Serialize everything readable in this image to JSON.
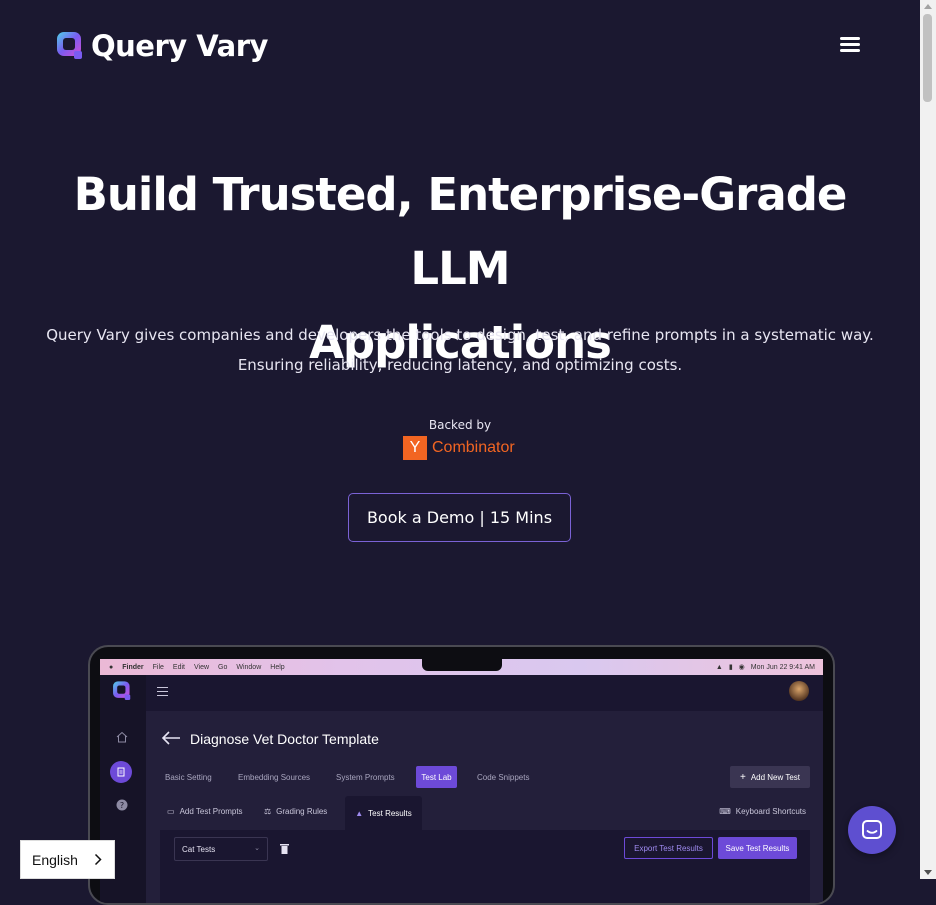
{
  "brand": {
    "name": "Query Vary"
  },
  "hero": {
    "title_line1": "Build Trusted, Enterprise-Grade LLM",
    "title_line2": "Applications",
    "subtitle_line1": "Query Vary gives companies and developers the tools to design, test, and refine prompts in a systematic way.",
    "subtitle_line2": "Ensuring reliability, reducing latency, and optimizing costs.",
    "backed_by": "Backed by",
    "yc_letter": "Y",
    "yc_name": "Combinator",
    "cta": "Book a Demo | 15 Mins"
  },
  "macbar": {
    "items": [
      "Finder",
      "File",
      "Edit",
      "View",
      "Go",
      "Window",
      "Help"
    ],
    "clock": "Mon Jun 22  9:41 AM"
  },
  "app": {
    "page_title": "Diagnose Vet Doctor Template",
    "tabs": [
      "Basic Setting",
      "Embedding Sources",
      "System Prompts",
      "Test Lab",
      "Code Snippets"
    ],
    "active_tab": "Test Lab",
    "add_test": "Add New Test",
    "subtabs": [
      "Add Test Prompts",
      "Grading Rules",
      "Test Results"
    ],
    "keyboard_shortcuts": "Keyboard Shortcuts",
    "select_value": "Cat Tests",
    "export_btn": "Export Test Results",
    "save_btn": "Save Test Results"
  },
  "language": {
    "current": "English"
  },
  "colors": {
    "background": "#1b1830",
    "accent": "#6d4ad8",
    "yc_orange": "#f26522"
  }
}
